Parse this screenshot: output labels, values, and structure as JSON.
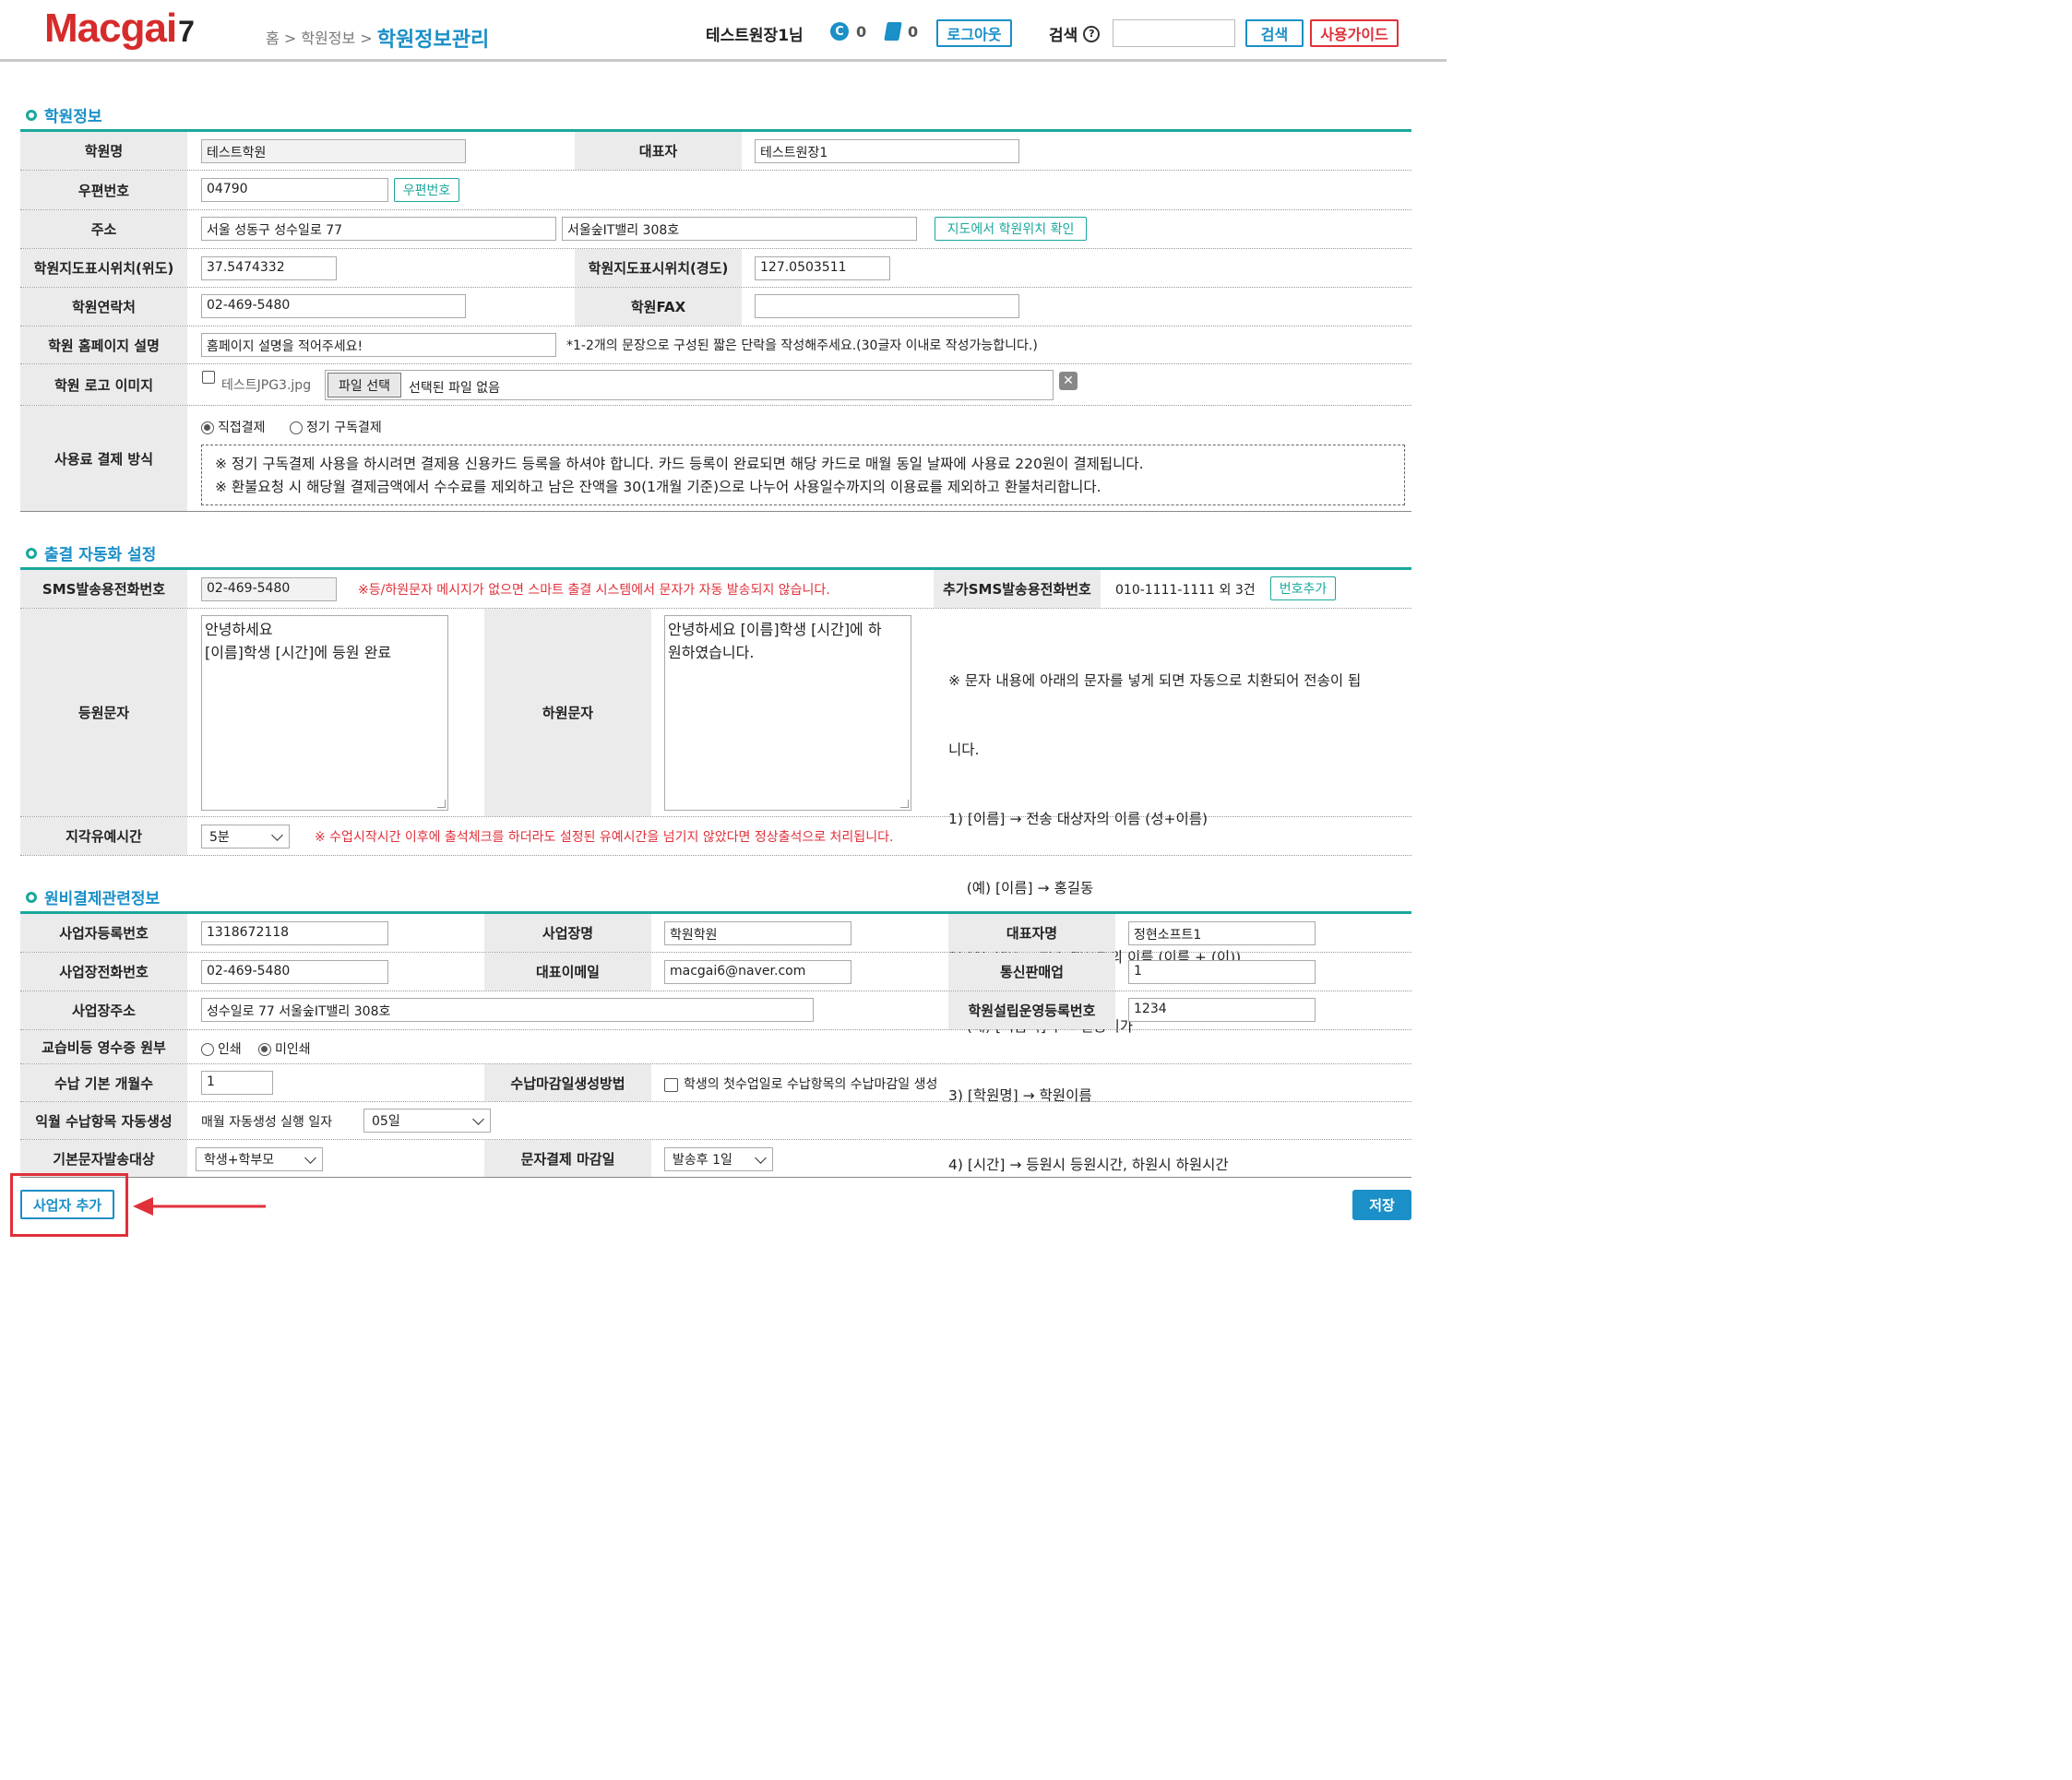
{
  "header": {
    "logo_main": "Macgai",
    "logo_num": "7",
    "breadcrumb_home": "홈",
    "breadcrumb_sep1": ">",
    "breadcrumb_mid": "학원정보",
    "breadcrumb_sep2": ">",
    "breadcrumb_current": "학원정보관리",
    "user_name": "테스트원장1님",
    "coin_count": "0",
    "badge_count": "0",
    "logout_label": "로그아웃",
    "search_label": "검색",
    "search_button": "검색",
    "guide_button": "사용가이드"
  },
  "section1": {
    "title": "학원정보",
    "academy_name_label": "학원명",
    "academy_name_value": "테스트학원",
    "rep_label": "대표자",
    "rep_value": "테스트원장1",
    "zip_label": "우편번호",
    "zip_value": "04790",
    "zip_button": "우편번호",
    "addr_label": "주소",
    "addr1_value": "서울 성동구 성수일로 77",
    "addr2_value": "서울숲IT밸리 308호",
    "map_button": "지도에서 학원위치 확인",
    "lat_label": "학원지도표시위치(위도)",
    "lat_value": "37.5474332",
    "lng_label": "학원지도표시위치(경도)",
    "lng_value": "127.0503511",
    "phone_label": "학원연락처",
    "phone_value": "02-469-5480",
    "fax_label": "학원FAX",
    "fax_value": "",
    "desc_label": "학원 홈페이지 설명",
    "desc_value": "홈페이지 설명을 적어주세요!",
    "desc_hint": "*1-2개의 문장으로 구성된 짧은 단락을 작성해주세요.(30글자 이내로 작성가능합니다.)",
    "logo_label": "학원 로고 이미지",
    "logo_file": "테스트JPG3.jpg",
    "file_button": "파일 선택",
    "file_none": "선택된 파일 없음",
    "pay_label": "사용료 결제 방식",
    "pay_opt1": "직접결제",
    "pay_opt2": "정기 구독결제",
    "pay_note1": "※ 정기 구독결제 사용을 하시려면 결제용 신용카드 등록을 하셔야 합니다. 카드 등록이 완료되면 해당 카드로 매월 동일 날짜에 사용료 220원이 결제됩니다.",
    "pay_note2": "※ 환불요청 시 해당월 결제금액에서 수수료를 제외하고 남은 잔액을 30(1개월 기준)으로 나누어 사용일수까지의 이용료를 제외하고 환불처리합니다."
  },
  "section2": {
    "title": "출결 자동화 설정",
    "sms_label": "SMS발송용전화번호",
    "sms_value": "02-469-5480",
    "sms_warn": "※등/하원문자 메시지가 없으면 스마트 출결 시스템에서 문자가 자동 발송되지 않습니다.",
    "extra_sms_label": "추가SMS발송용전화번호",
    "extra_sms_value": "010-1111-1111 외 3건",
    "add_number_button": "번호추가",
    "arrive_label": "등원문자",
    "arrive_line1": "안녕하세요",
    "arrive_line2": "[이름]학생 [시간]에 등원 완료",
    "leave_label": "하원문자",
    "leave_line1": "안녕하세요 [이름]학생 [시간]에 하",
    "leave_line2": "원하였습니다.",
    "guide_lines": [
      "※ 문자 내용에 아래의 문자를 넣게 되면 자동으로 치환되어 전송이 됩",
      "니다.",
      "1) [이름] → 전송 대상자의 이름 (성+이름)",
      "    (예) [이름] → 홍길동",
      "2) [이름이] → 전송 대상자의 이름 (이름 + (이))",
      "    (예) [이름이]가 → 길동이가",
      "3) [학원명] → 학원이름",
      "4) [시간] → 등원시 등원시간, 하원시 하원시간"
    ],
    "late_label": "지각유예시간",
    "late_value": "5분",
    "late_warn": "※ 수업시작시간 이후에 출석체크를 하더라도 설정된 유예시간을 넘기지 않았다면 정상출석으로 처리됩니다."
  },
  "section3": {
    "title": "원비결제관련정보",
    "bizno_label": "사업자등록번호",
    "bizno_value": "1318672118",
    "bizname_label": "사업장명",
    "bizname_value": "학원학원",
    "ceo_label": "대표자명",
    "ceo_value": "정현소프트1",
    "bizphone_label": "사업장전화번호",
    "bizphone_value": "02-469-5480",
    "email_label": "대표이메일",
    "email_value": "macgai6@naver.com",
    "ecom_label": "통신판매업",
    "ecom_value": "1",
    "bizaddr_label": "사업장주소",
    "bizaddr_value": "성수일로 77 서울숲IT밸리 308호",
    "regno_label": "학원설립운영등록번호",
    "regno_value": "1234",
    "receipt_label": "교습비등 영수증 원부",
    "receipt_opt1": "인쇄",
    "receipt_opt2": "미인쇄",
    "months_label": "수납 기본 개월수",
    "months_value": "1",
    "deadline_label": "수납마감일생성방법",
    "deadline_check": "학생의 첫수업일로 수납항목의 수납마감일 생성",
    "auto_label": "익월 수납항목 자동생성",
    "auto_text": "매월 자동생성 실행 일자",
    "auto_value": "05일",
    "target_label": "기본문자발송대상",
    "target_value": "학생+학부모",
    "msgdue_label": "문자결제 마감일",
    "msgdue_value": "발송후 1일"
  },
  "footer": {
    "add_biz_button": "사업자 추가",
    "save_button": "저장"
  },
  "colors": {
    "accent_blue": "#1a8fc8",
    "teal_line": "#1aa89c",
    "warn_red": "#e0303a",
    "label_bg": "#ebebeb"
  }
}
